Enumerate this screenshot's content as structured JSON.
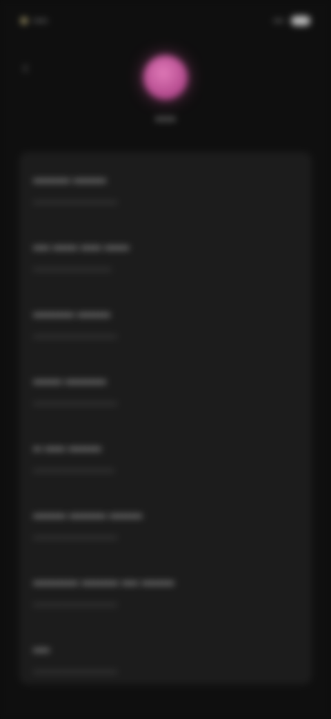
{
  "status_bar": {
    "time": "••••",
    "right_text": "•••"
  },
  "header": {
    "back_icon": "chevron-left-icon",
    "title": "••••",
    "avatar_color": "#d165a6"
  },
  "list": {
    "items": [
      {
        "title": "••••••••• ••••••••",
        "subtitle": "•••••••••••••••••••••••••••••"
      },
      {
        "title": "•••• •••••• ••••• ••••••",
        "subtitle": "•••••••••••••••••••••••••••"
      },
      {
        "title": "•••••••••• ••••••••",
        "subtitle": "•••••••••••••••••••••••••••••"
      },
      {
        "title": "••••••• ••••••••••",
        "subtitle": "•••••••••••••••••••••••••••••"
      },
      {
        "title": "•• ••••• ••••••••",
        "subtitle": "••••••••••••••••••••••••••••"
      },
      {
        "title": "•••••••• ••••••••• ••••••••",
        "subtitle": "•••••••••••••••••••••••••••••"
      },
      {
        "title": "••••••••••• ••••••••• •••• ••••••••",
        "subtitle": "•••••••••••••••••••••••••••••"
      },
      {
        "title": "••••",
        "subtitle": "•••••••••••••••••••••••••••••"
      }
    ]
  }
}
